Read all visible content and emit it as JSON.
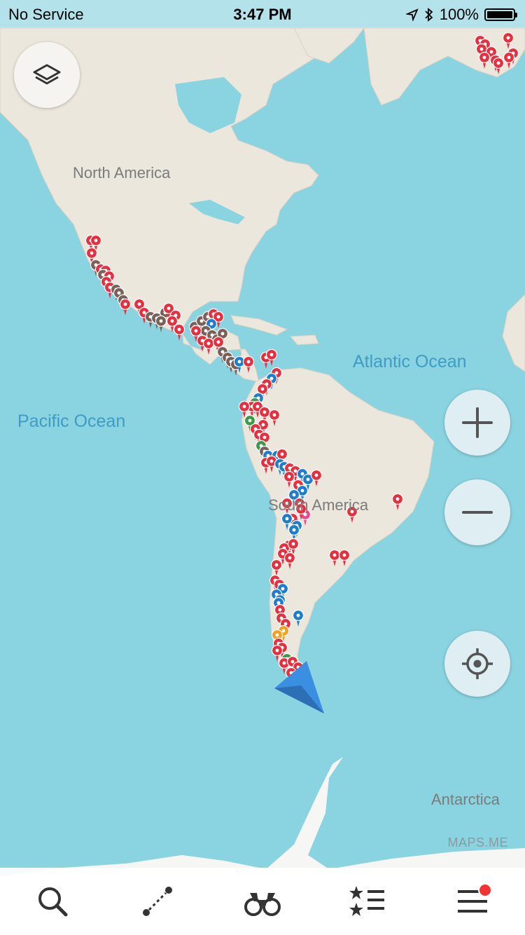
{
  "status_bar": {
    "carrier": "No Service",
    "time": "3:47 PM",
    "battery": "100%",
    "battery_level": 1.0
  },
  "map": {
    "labels": {
      "north_america": "North America",
      "atlantic_ocean": "Atlantic Ocean",
      "pacific_ocean": "Pacific Ocean",
      "south_america": "South America",
      "antarctica": "Antarctica"
    },
    "watermark": "MAPS.ME",
    "colors": {
      "water": "#8ad3e0",
      "land": "#ebe7dc",
      "pin_red": "#e53040",
      "pin_brown": "#7a6058",
      "pin_blue": "#1e7ecb",
      "pin_green": "#3a9a4a",
      "pin_orange": "#f4a020",
      "pin_pink": "#e84a8a",
      "position_arrow": "#3b8fe0"
    }
  },
  "controls": {
    "layers": "layers-icon",
    "zoom_in": "plus-icon",
    "zoom_out": "minus-icon",
    "my_position": "crosshair-icon"
  },
  "bottom_bar": {
    "tabs": [
      {
        "icon": "search-icon"
      },
      {
        "icon": "route-icon"
      },
      {
        "icon": "binoculars-icon"
      },
      {
        "icon": "bookmarks-icon"
      },
      {
        "icon": "menu-icon",
        "badge": true
      }
    ]
  }
}
